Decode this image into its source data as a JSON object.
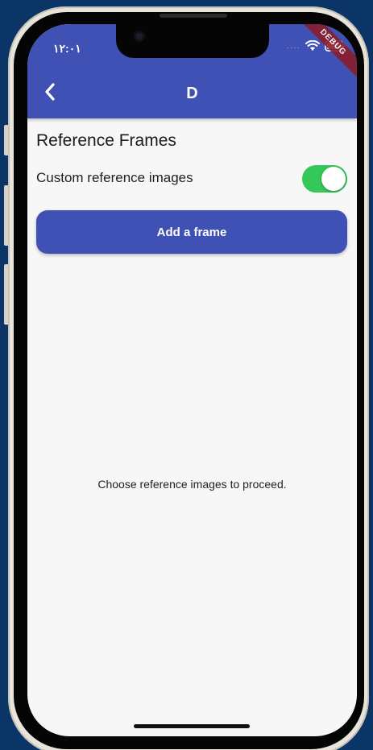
{
  "status_bar": {
    "time": "۱۲:۰۱",
    "signal_icon": "signal-dots-icon",
    "wifi_icon": "wifi-icon",
    "battery_icon": "battery-icon"
  },
  "debug_banner": {
    "label": "DEBUG",
    "color": "#8b1c2b"
  },
  "app_bar": {
    "title": "D",
    "back_icon": "chevron-left-icon",
    "color": "#3f51b5"
  },
  "main": {
    "section_title": "Reference Frames",
    "toggle": {
      "label": "Custom reference images",
      "on": true,
      "color": "#34c759"
    },
    "add_button_label": "Add a frame",
    "empty_message": "Choose reference images to proceed."
  }
}
